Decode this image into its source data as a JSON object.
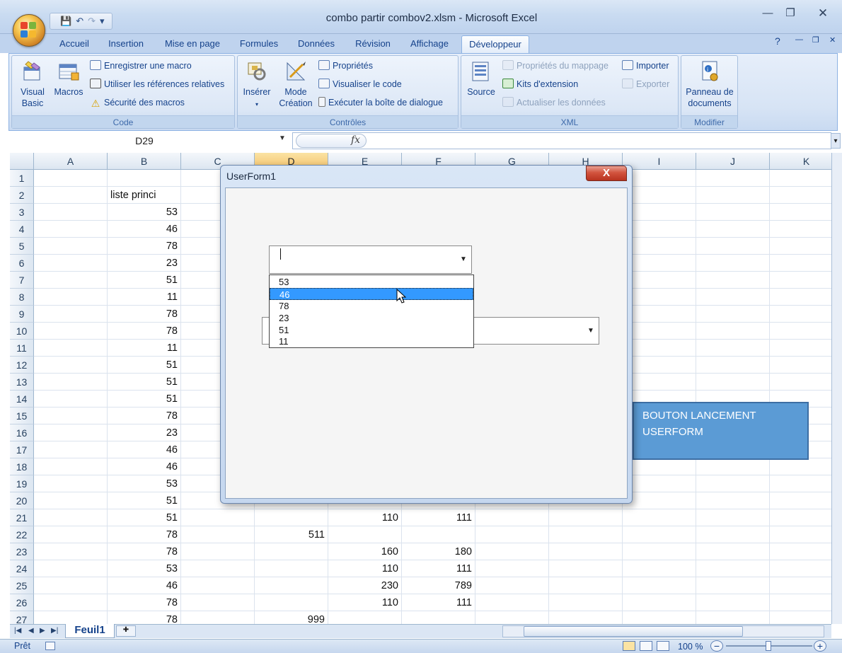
{
  "window": {
    "title": "combo partir combov2.xlsm - Microsoft Excel",
    "minimize": "—",
    "maximize": "❐",
    "close": "✕"
  },
  "quick_access": {
    "save": "💾",
    "undo": "↶",
    "redo": "↷",
    "customize": "▾"
  },
  "ribbon": {
    "tabs": [
      "Accueil",
      "Insertion",
      "Mise en page",
      "Formules",
      "Données",
      "Révision",
      "Affichage",
      "Développeur"
    ],
    "active_tab": "Développeur",
    "help": "?",
    "groups": {
      "code": {
        "label": "Code",
        "visual_basic": "Visual Basic",
        "macros": "Macros",
        "record_macro": "Enregistrer une macro",
        "relative_refs": "Utiliser les références relatives",
        "macro_security": "Sécurité des macros"
      },
      "controls": {
        "label": "Contrôles",
        "insert": "Insérer",
        "design_mode": "Mode Création",
        "properties": "Propriétés",
        "view_code": "Visualiser le code",
        "run_dialog": "Exécuter la boîte de dialogue"
      },
      "xml": {
        "label": "XML",
        "source": "Source",
        "map_properties": "Propriétés du mappage",
        "expansion_packs": "Kits d'extension",
        "refresh_data": "Actualiser les données",
        "import": "Importer",
        "export": "Exporter"
      },
      "modify": {
        "label": "Modifier",
        "document_panel": "Panneau de documents"
      }
    }
  },
  "formula_bar": {
    "name_box": "D29",
    "fx": "fx",
    "value": ""
  },
  "grid": {
    "columns": [
      "A",
      "B",
      "C",
      "D",
      "E",
      "F",
      "G",
      "H",
      "I",
      "J",
      "K"
    ],
    "selected_column": "D",
    "rows": [
      {
        "n": "1",
        "B": "",
        "D": "",
        "E": "",
        "F": ""
      },
      {
        "n": "2",
        "B": "liste princi",
        "D": "",
        "E": "",
        "F": ""
      },
      {
        "n": "3",
        "B": "53",
        "D": "",
        "E": "",
        "F": ""
      },
      {
        "n": "4",
        "B": "46",
        "D": "",
        "E": "",
        "F": ""
      },
      {
        "n": "5",
        "B": "78",
        "D": "",
        "E": "",
        "F": ""
      },
      {
        "n": "6",
        "B": "23",
        "D": "",
        "E": "",
        "F": ""
      },
      {
        "n": "7",
        "B": "51",
        "D": "",
        "E": "",
        "F": ""
      },
      {
        "n": "8",
        "B": "11",
        "D": "",
        "E": "",
        "F": ""
      },
      {
        "n": "9",
        "B": "78",
        "D": "",
        "E": "",
        "F": ""
      },
      {
        "n": "10",
        "B": "78",
        "D": "",
        "E": "",
        "F": ""
      },
      {
        "n": "11",
        "B": "11",
        "D": "",
        "E": "",
        "F": ""
      },
      {
        "n": "12",
        "B": "51",
        "D": "",
        "E": "",
        "F": ""
      },
      {
        "n": "13",
        "B": "51",
        "D": "",
        "E": "",
        "F": ""
      },
      {
        "n": "14",
        "B": "51",
        "D": "",
        "E": "",
        "F": ""
      },
      {
        "n": "15",
        "B": "78",
        "D": "",
        "E": "",
        "F": ""
      },
      {
        "n": "16",
        "B": "23",
        "D": "",
        "E": "",
        "F": ""
      },
      {
        "n": "17",
        "B": "46",
        "D": "",
        "E": "",
        "F": ""
      },
      {
        "n": "18",
        "B": "46",
        "D": "",
        "E": "",
        "F": ""
      },
      {
        "n": "19",
        "B": "53",
        "D": "",
        "E": "",
        "F": ""
      },
      {
        "n": "20",
        "B": "51",
        "D": "",
        "E": "",
        "F": ""
      },
      {
        "n": "21",
        "B": "51",
        "D": "",
        "E": "110",
        "F": "111"
      },
      {
        "n": "22",
        "B": "78",
        "D": "511",
        "E": "",
        "F": ""
      },
      {
        "n": "23",
        "B": "78",
        "D": "",
        "E": "160",
        "F": "180"
      },
      {
        "n": "24",
        "B": "53",
        "D": "",
        "E": "110",
        "F": "111"
      },
      {
        "n": "25",
        "B": "46",
        "D": "",
        "E": "230",
        "F": "789"
      },
      {
        "n": "26",
        "B": "78",
        "D": "",
        "E": "110",
        "F": "111"
      },
      {
        "n": "27",
        "B": "78",
        "D": "999",
        "E": "",
        "F": ""
      }
    ]
  },
  "shape_button": {
    "label": "BOUTON LANCEMENT USERFORM",
    "color": "#5b9bd5"
  },
  "sheet_tabs": {
    "active": "Feuil1"
  },
  "status_bar": {
    "status": "Prêt",
    "zoom": "100 %",
    "zoom_out": "−",
    "zoom_in": "+"
  },
  "userform": {
    "title": "UserForm1",
    "close": "X",
    "combo1_value": "",
    "combo2_value": "",
    "dropdown_items": [
      "53",
      "46",
      "78",
      "23",
      "51",
      "11"
    ],
    "selected_item": "46"
  },
  "colors": {
    "accent": "#15428b",
    "ribbon": "#dbe7f6",
    "selection": "#3399ff",
    "close_red": "#c8432d"
  }
}
